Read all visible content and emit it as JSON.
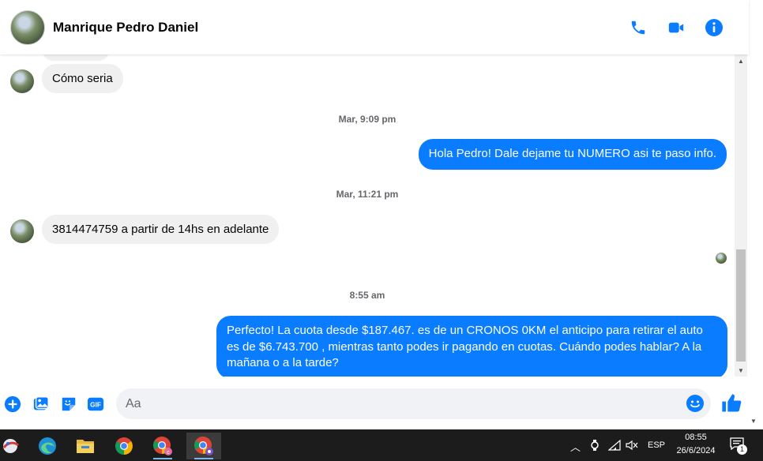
{
  "header": {
    "contact_name": "Manrique Pedro Daniel",
    "actions": [
      {
        "icon": "phone-icon"
      },
      {
        "icon": "video-camera-icon"
      },
      {
        "icon": "info-icon"
      }
    ]
  },
  "colors": {
    "accent": "#0a7cff",
    "incoming_bubble": "#f0f0f0",
    "taskbar": "#1c1c1c"
  },
  "conversation": {
    "messages": [
      {
        "direction": "incoming",
        "text": "Cómo seria"
      },
      {
        "type": "timestamp",
        "text": "Mar, 9:09 pm"
      },
      {
        "direction": "outgoing",
        "text": "Hola Pedro! Dale dejame tu NUMERO asi te paso info."
      },
      {
        "type": "timestamp",
        "text": "Mar, 11:21 pm"
      },
      {
        "direction": "incoming",
        "text": "3814474759 a partir de 14hs en adelante"
      },
      {
        "type": "timestamp",
        "text": "8:55 am"
      },
      {
        "direction": "outgoing",
        "text": "Perfecto! La cuota desde $187.467. es de un CRONOS 0KM el anticipo para retirar el auto es de $6.743.700 , mientras tanto podes ir pagando en cuotas. Cuándo podes hablar? A la mañana o a la tarde?"
      }
    ]
  },
  "composer": {
    "placeholder": "Aa",
    "tools": [
      "plus-icon",
      "image-icon",
      "sticker-icon",
      "gif-icon"
    ],
    "gif_label": "GIF"
  },
  "taskbar": {
    "apps": [
      "start-icon",
      "edge-icon",
      "file-explorer-icon",
      "chrome-icon",
      "chrome-profile-c-icon",
      "chrome-profile-incognito-icon"
    ],
    "tray": {
      "language": "ESP",
      "time": "08:55",
      "date": "26/6/2024",
      "notification_count": "1"
    }
  }
}
